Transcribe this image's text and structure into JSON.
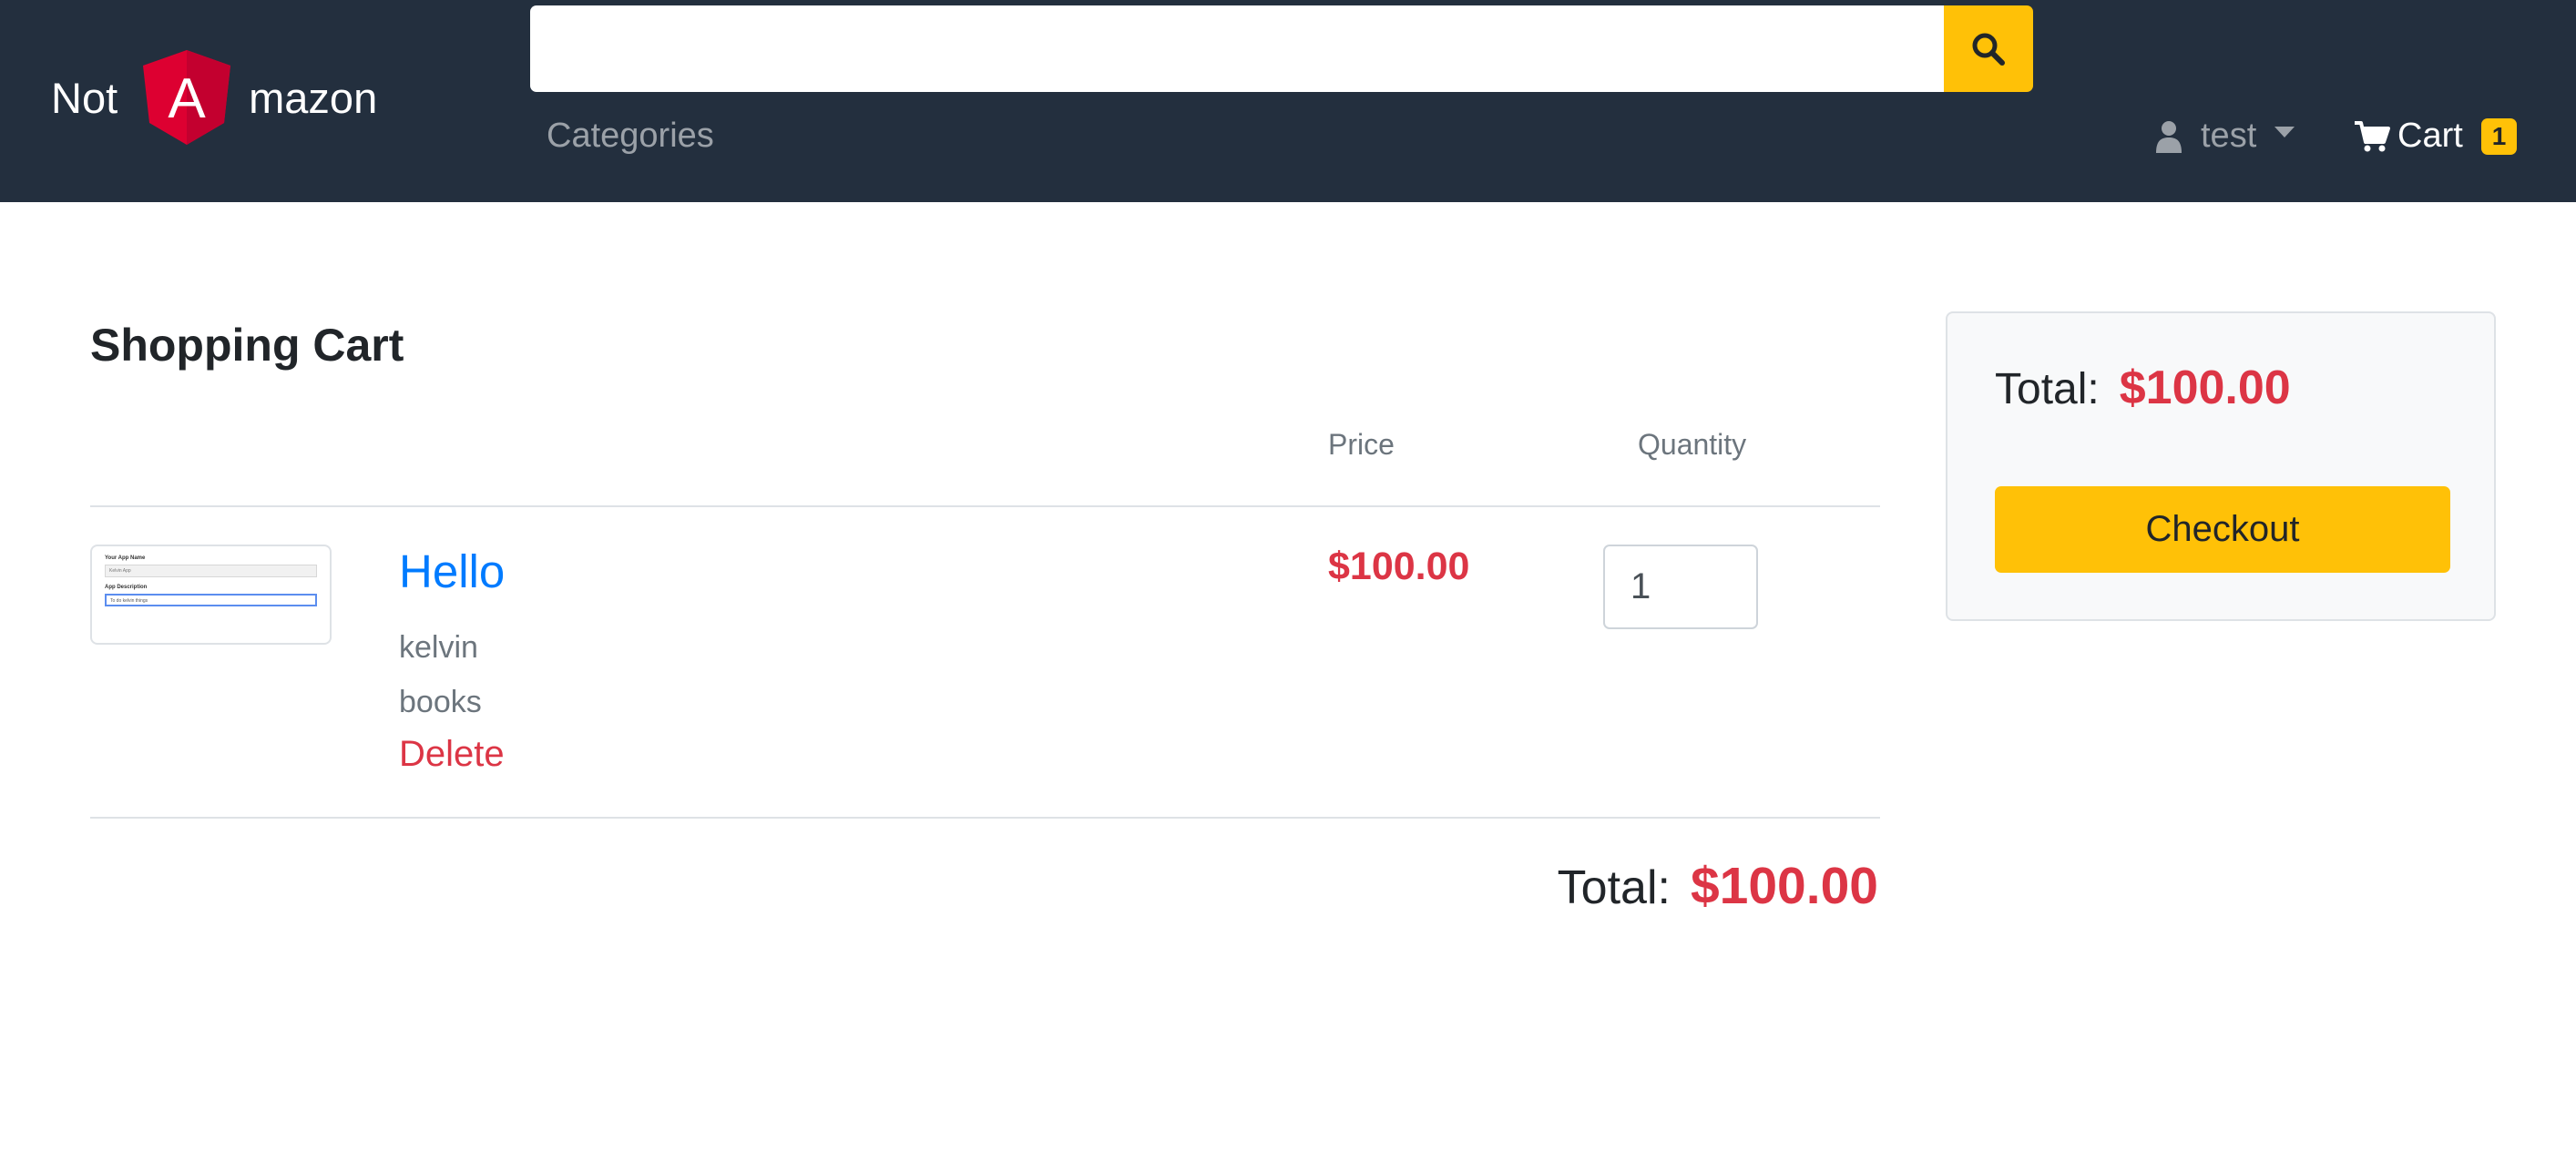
{
  "header": {
    "brand_left": "Not",
    "brand_logo_letter": "A",
    "brand_right": "mazon",
    "search": {
      "placeholder": "",
      "value": "",
      "icon": "search-icon"
    },
    "categories_label": "Categories",
    "user": {
      "name": "test",
      "icon": "user-icon"
    },
    "cart": {
      "label": "Cart",
      "count": "1",
      "icon": "shopping-cart-icon"
    }
  },
  "colors": {
    "navbar": "#232f3e",
    "accent": "#ffc107",
    "price": "#dc3545",
    "link": "#007bff",
    "logo_red": "#dd0031"
  },
  "cart_page": {
    "title": "Shopping Cart",
    "columns": {
      "price": "Price",
      "quantity": "Quantity"
    },
    "items": [
      {
        "title": "Hello",
        "seller": "kelvin",
        "category": "books",
        "delete_label": "Delete",
        "price": "$100.00",
        "quantity": "1",
        "thumbnail": {
          "label_1": "Your App Name",
          "field_1": "Kelvin App",
          "label_2": "App Description",
          "field_2": "To do kelvin things"
        }
      }
    ],
    "total_label": "Total:",
    "total_value": "$100.00"
  },
  "summary": {
    "total_label": "Total:",
    "total_value": "$100.00",
    "checkout_label": "Checkout"
  }
}
